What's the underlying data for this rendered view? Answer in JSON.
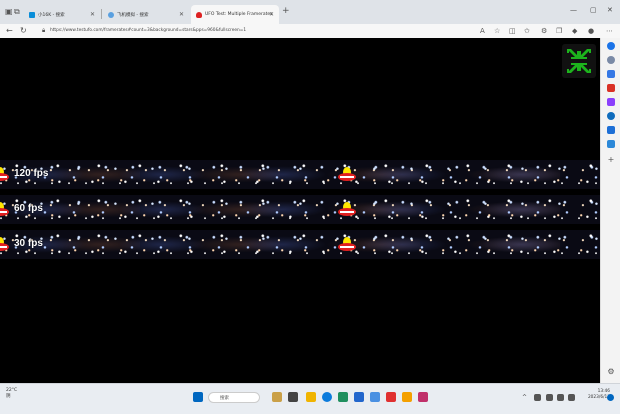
{
  "browser": {
    "tabs": [
      {
        "label": "小16K - 搜索",
        "active": false,
        "icon": "bing-icon"
      },
      {
        "label": "飞机模拟 - 搜索",
        "active": false,
        "icon": "search-icon"
      },
      {
        "label": "UFO Test: Multiple Framerates",
        "active": true,
        "icon": "ufo-favicon"
      }
    ],
    "new_tab_label": "+",
    "address": "https://www.testufo.com/framerates#count=3&background=stars&pps=960&fullscreen=1",
    "window_controls": {
      "minimize": "—",
      "maximize": "▢",
      "close": "✕"
    }
  },
  "content": {
    "rows": [
      {
        "fps_label": "120 fps"
      },
      {
        "fps_label": "60 fps"
      },
      {
        "fps_label": "30 fps"
      }
    ]
  },
  "taskbar": {
    "weather_temp": "22°C",
    "weather_desc": "阴",
    "search_placeholder": "搜索",
    "clock_time": "13:46",
    "clock_date": "2023/6/13"
  },
  "colors": {
    "accent": "#0067c0",
    "exit_fullscreen_arrows": "#1db31d",
    "fps_text": "#ffffff"
  }
}
